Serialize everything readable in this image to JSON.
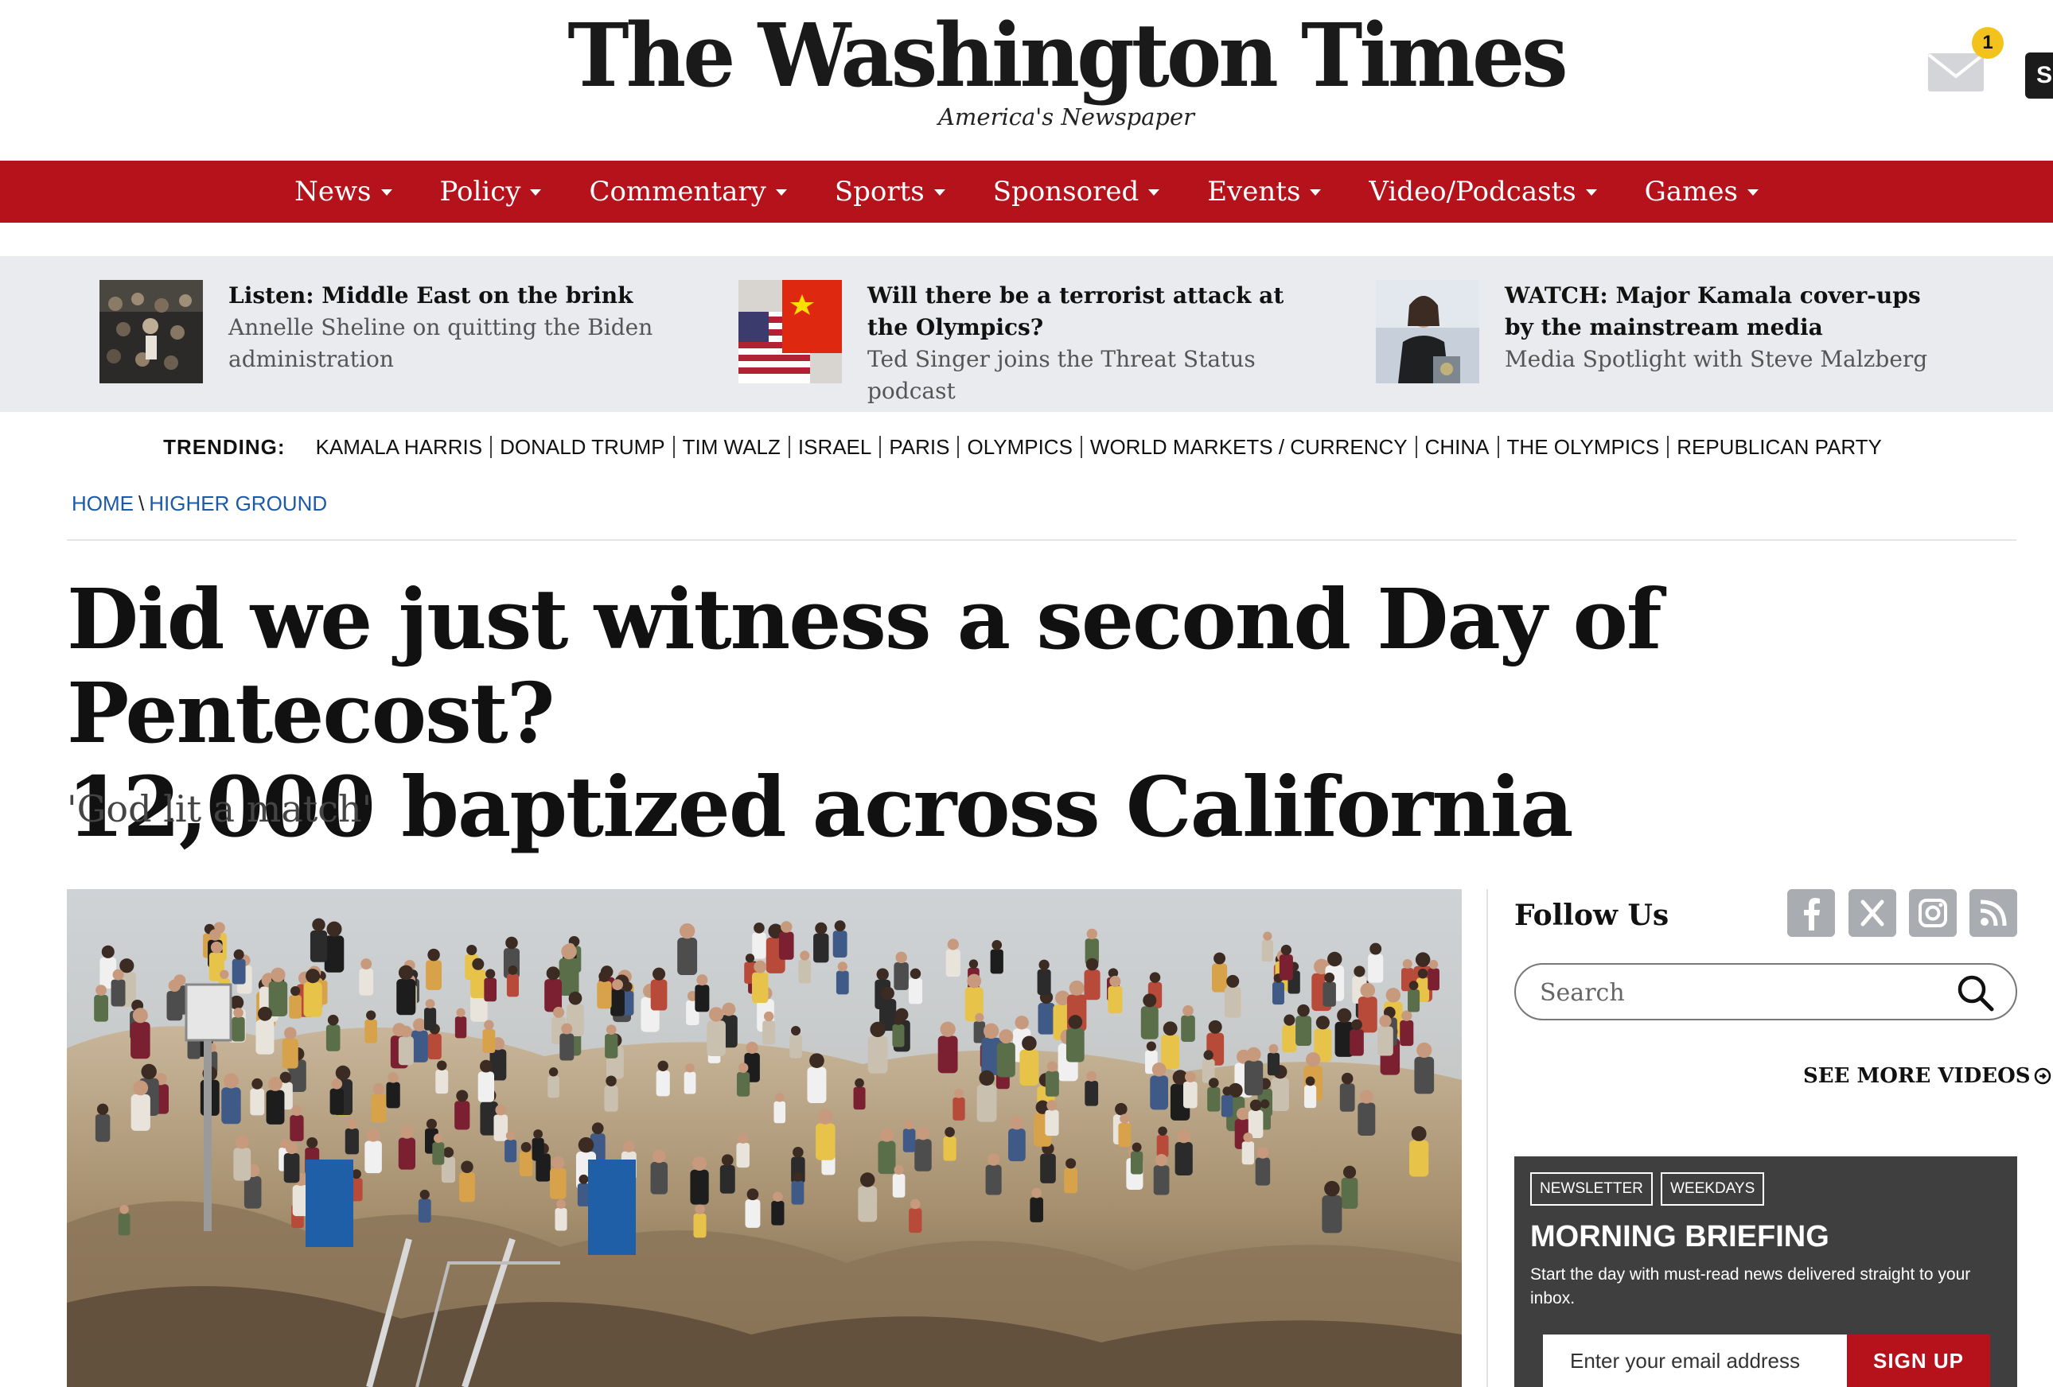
{
  "masthead": {
    "logo_text": "The Washington Times",
    "tagline": "America's Newspaper",
    "mail_badge_count": "1",
    "subscribe_partial": "S"
  },
  "nav": {
    "items": [
      {
        "label": "News"
      },
      {
        "label": "Policy"
      },
      {
        "label": "Commentary"
      },
      {
        "label": "Sports"
      },
      {
        "label": "Sponsored"
      },
      {
        "label": "Events"
      },
      {
        "label": "Video/Podcasts"
      },
      {
        "label": "Games"
      }
    ]
  },
  "promo": {
    "items": [
      {
        "title": "Listen: Middle East on the brink",
        "subtitle": "Annelle Sheline on quitting the Biden administration"
      },
      {
        "title": "Will there be a terrorist attack at the Olympics?",
        "subtitle": "Ted Singer joins the Threat Status podcast"
      },
      {
        "title": "WATCH: Major Kamala cover-ups by the mainstream media",
        "subtitle": "Media Spotlight with Steve Malzberg"
      }
    ]
  },
  "trending": {
    "label": "TRENDING:",
    "items": [
      "KAMALA HARRIS",
      "DONALD TRUMP",
      "TIM WALZ",
      "ISRAEL",
      "PARIS",
      "OLYMPICS",
      "WORLD MARKETS / CURRENCY",
      "CHINA",
      "THE OLYMPICS",
      "REPUBLICAN PARTY"
    ]
  },
  "breadcrumb": {
    "home": "HOME",
    "separator": "\\",
    "section": "HIGHER GROUND"
  },
  "article": {
    "headline_line1": "Did we just witness a second Day of Pentecost?",
    "headline_line2": "12,000 baptized across California",
    "dek": "'God lit a match'"
  },
  "sidebar": {
    "follow_label": "Follow Us",
    "social_icons": [
      "facebook-icon",
      "x-icon",
      "instagram-icon",
      "rss-icon"
    ],
    "search_placeholder": "Search",
    "see_more": "SEE MORE VIDEOS"
  },
  "newsletter": {
    "tag1": "NEWSLETTER",
    "tag2": "WEEKDAYS",
    "title": "MORNING BRIEFING",
    "description": "Start the day with must-read news delivered straight to your inbox.",
    "email_placeholder": "Enter your email address",
    "signup_label": "SIGN UP"
  },
  "colors": {
    "nav_red": "#b5121b",
    "promo_bg": "#e9ebef",
    "link_blue": "#1d5aa6",
    "newsletter_bg": "#3f3f3f",
    "badge_yellow": "#f2c31c"
  }
}
